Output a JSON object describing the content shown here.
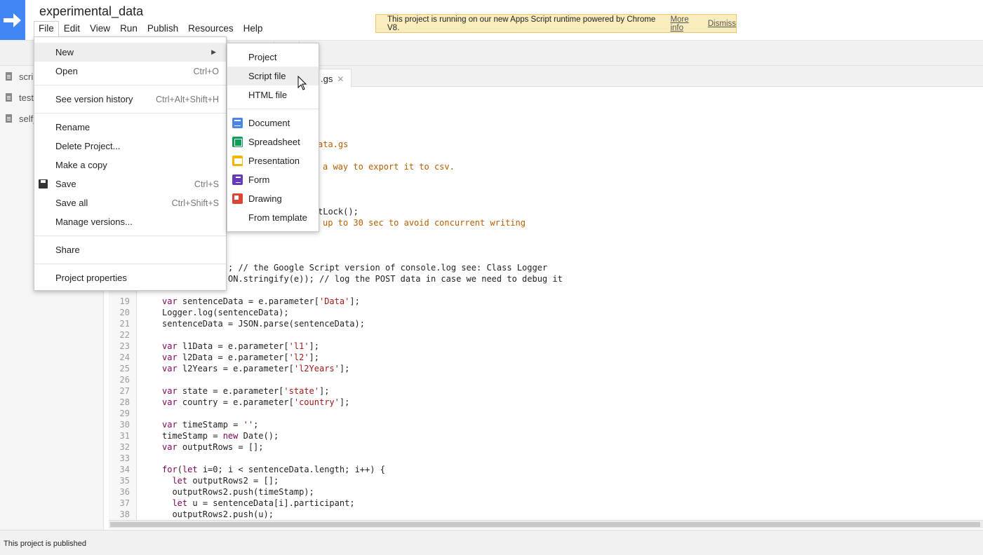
{
  "header": {
    "project_title": "experimental_data",
    "menu": [
      "File",
      "Edit",
      "View",
      "Run",
      "Publish",
      "Resources",
      "Help"
    ]
  },
  "banner": {
    "text": "This project is running on our new Apps Script runtime powered by Chrome V8.",
    "more_info": "More info",
    "dismiss": "Dismiss"
  },
  "sidebar": {
    "files": [
      "scrip",
      "test",
      "self_"
    ]
  },
  "editor": {
    "tab_label": ".gs",
    "visible_fragments": [
      {
        "text": "ata.gs"
      },
      {
        "text": "a way to export it to csv."
      },
      {
        "text": "tLock();"
      },
      {
        "text": "up to 30 sec to avoid concurrent writing"
      },
      {
        "text": "; // the Google Script version of console.log see: Class Logger"
      },
      {
        "text": "ON.stringify(e)); // log the POST data in case we need to debug it"
      }
    ],
    "lines": [
      {
        "n": "19",
        "code": "var sentenceData = e.parameter['Data'];"
      },
      {
        "n": "20",
        "code": "Logger.log(sentenceData);"
      },
      {
        "n": "21",
        "code": "sentenceData = JSON.parse(sentenceData);"
      },
      {
        "n": "22",
        "code": ""
      },
      {
        "n": "23",
        "code": "var l1Data = e.parameter['l1'];"
      },
      {
        "n": "24",
        "code": "var l2Data = e.parameter['l2'];"
      },
      {
        "n": "25",
        "code": "var l2Years = e.parameter['l2Years'];"
      },
      {
        "n": "26",
        "code": ""
      },
      {
        "n": "27",
        "code": "var state = e.parameter['state'];"
      },
      {
        "n": "28",
        "code": "var country = e.parameter['country'];"
      },
      {
        "n": "29",
        "code": ""
      },
      {
        "n": "30",
        "code": "var timeStamp = '';"
      },
      {
        "n": "31",
        "code": "timeStamp = new Date();"
      },
      {
        "n": "32",
        "code": "var outputRows = [];"
      },
      {
        "n": "33",
        "code": ""
      },
      {
        "n": "34",
        "code": "for(let i=0; i < sentenceData.length; i++) {"
      },
      {
        "n": "35",
        "code": "  let outputRows2 = [];"
      },
      {
        "n": "36",
        "code": "  outputRows2.push(timeStamp);"
      },
      {
        "n": "37",
        "code": "  let u = sentenceData[i].participant;"
      },
      {
        "n": "38",
        "code": "  outputRows2.push(u);"
      }
    ]
  },
  "status": {
    "text": "This project is published"
  },
  "file_menu": {
    "items": [
      {
        "label": "New",
        "shortcut": "",
        "submenu": true
      },
      {
        "label": "Open",
        "shortcut": "Ctrl+O"
      },
      {
        "label": "See version history",
        "shortcut": "Ctrl+Alt+Shift+H"
      },
      {
        "label": "Rename",
        "shortcut": ""
      },
      {
        "label": "Delete Project...",
        "shortcut": ""
      },
      {
        "label": "Make a copy",
        "shortcut": ""
      },
      {
        "label": "Save",
        "shortcut": "Ctrl+S"
      },
      {
        "label": "Save all",
        "shortcut": "Ctrl+Shift+S"
      },
      {
        "label": "Manage versions...",
        "shortcut": ""
      },
      {
        "label": "Share",
        "shortcut": ""
      },
      {
        "label": "Project properties",
        "shortcut": ""
      }
    ]
  },
  "new_submenu": {
    "items": [
      "Project",
      "Script file",
      "HTML file",
      "Document",
      "Spreadsheet",
      "Presentation",
      "Form",
      "Drawing",
      "From template"
    ],
    "icons": [
      "",
      "",
      "",
      "document-icon",
      "spreadsheet-icon",
      "presentation-icon",
      "form-icon",
      "drawing-icon",
      ""
    ]
  },
  "colors": {
    "logo_blue": "#4285f4",
    "comment": "#b85c00",
    "keyword": "#7f0055",
    "string": "#a31515",
    "banner_bg": "#f9edbe"
  }
}
